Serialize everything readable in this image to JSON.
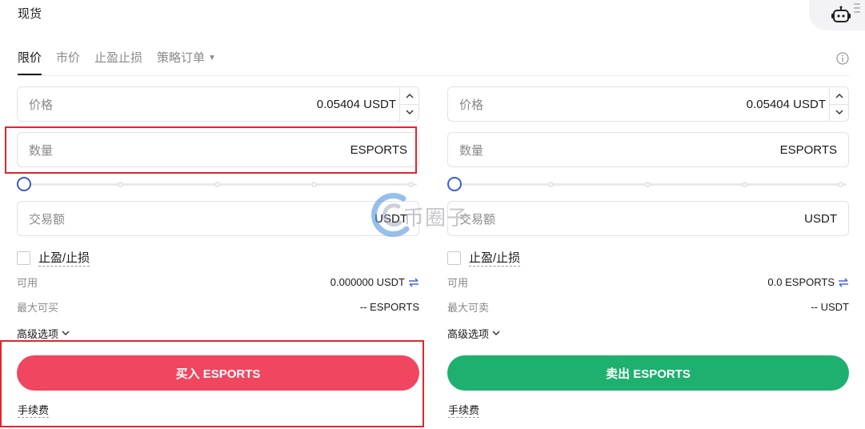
{
  "header": {
    "title": "现货"
  },
  "tabs": [
    {
      "label": "限价",
      "active": true
    },
    {
      "label": "市价",
      "active": false
    },
    {
      "label": "止盈止损",
      "active": false
    },
    {
      "label": "策略订单",
      "active": false,
      "has_dropdown": true
    }
  ],
  "buy": {
    "price_label": "价格",
    "price_value": "0.05404 USDT",
    "qty_label": "数量",
    "qty_unit": "ESPORTS",
    "amount_label": "交易额",
    "amount_unit": "USDT",
    "tpsl_label": "止盈/止损",
    "available_label": "可用",
    "available_value": "0.000000 USDT",
    "max_label": "最大可买",
    "max_value": "-- ESPORTS",
    "advanced_label": "高级选项",
    "button_label": "买入 ESPORTS",
    "fee_label": "手续费",
    "slider_percent": 0
  },
  "sell": {
    "price_label": "价格",
    "price_value": "0.05404 USDT",
    "qty_label": "数量",
    "qty_unit": "ESPORTS",
    "amount_label": "交易额",
    "amount_unit": "USDT",
    "tpsl_label": "止盈/止损",
    "available_label": "可用",
    "available_value": "0.0 ESPORTS",
    "max_label": "最大可卖",
    "max_value": "-- USDT",
    "advanced_label": "高级选项",
    "button_label": "卖出 ESPORTS",
    "fee_label": "手续费",
    "slider_percent": 0
  },
  "watermark": {
    "text": "币圈子"
  },
  "colors": {
    "buy": "#f0465f",
    "sell": "#1eb06e",
    "slider_knob": "#3a5bd6",
    "highlight": "#e0262e"
  },
  "icons": {
    "robot": "robot-icon",
    "info": "info-icon",
    "stepper_up": "chevron-up-icon",
    "stepper_down": "chevron-down-icon",
    "swap": "swap-icon",
    "advanced_caret": "chevron-down-icon"
  }
}
